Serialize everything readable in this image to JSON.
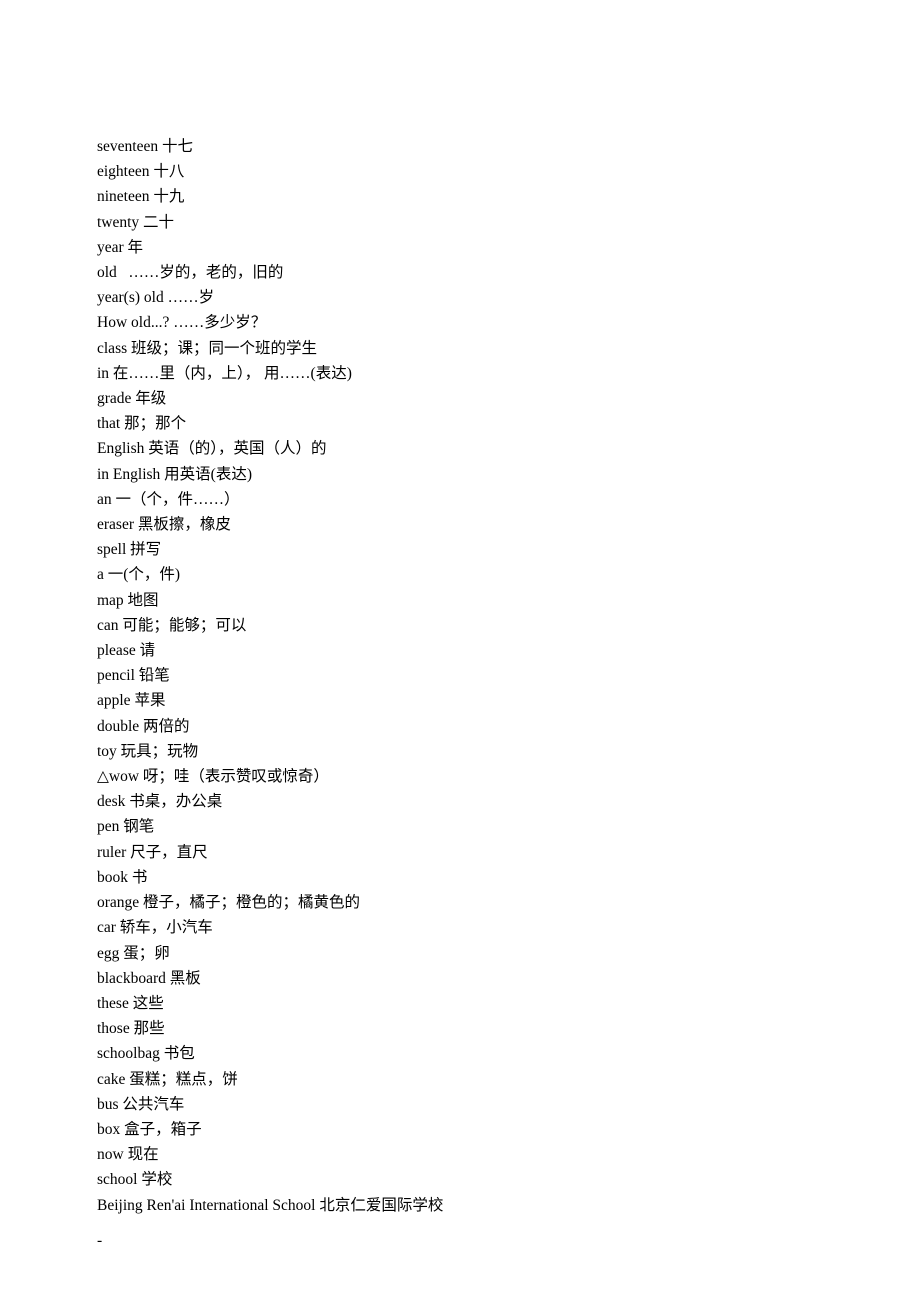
{
  "entries": [
    "seventeen 十七",
    "eighteen 十八",
    "nineteen 十九",
    "twenty 二十",
    "year 年",
    "old   ……岁的，老的，旧的",
    "year(s) old ……岁",
    "How old...? ……多少岁？",
    "class 班级；课；同一个班的学生",
    "in 在……里（内，上）， 用……(表达)",
    "grade 年级",
    "that 那；那个",
    "English 英语（的），英国（人）的",
    "in English 用英语(表达)",
    "an 一（个，件……）",
    "eraser 黑板擦，橡皮",
    "spell 拼写",
    "a 一(个，件)",
    "map 地图",
    "can 可能；能够；可以",
    "please 请",
    "pencil 铅笔",
    "apple 苹果",
    "double 两倍的",
    "toy 玩具；玩物",
    "△wow 呀；哇（表示赞叹或惊奇）",
    "desk 书桌，办公桌",
    "pen 钢笔",
    "ruler 尺子，直尺",
    "book 书",
    "orange 橙子，橘子；橙色的；橘黄色的",
    "car 轿车，小汽车",
    "egg 蛋；卵",
    "blackboard 黑板",
    "these 这些",
    "those 那些",
    "schoolbag 书包",
    "cake 蛋糕；糕点，饼",
    "bus 公共汽车",
    "box 盒子，箱子",
    "now 现在",
    "school 学校",
    "Beijing Ren'ai International School 北京仁爱国际学校"
  ],
  "footer": "-"
}
